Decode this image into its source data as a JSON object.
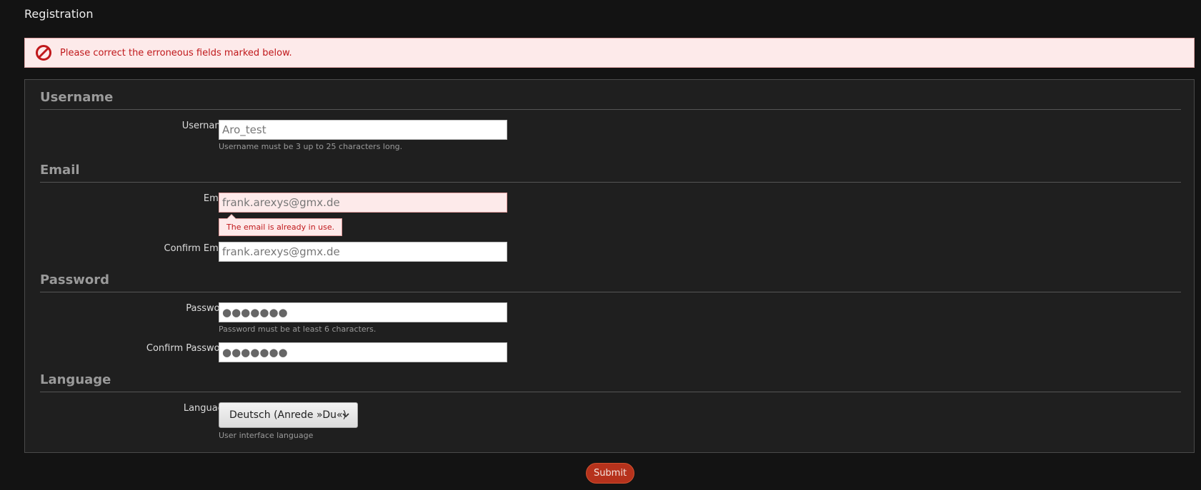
{
  "page": {
    "title": "Registration"
  },
  "alert": {
    "message": "Please correct the erroneous fields marked below.",
    "icon": "no-entry-icon",
    "color": "#c0181b"
  },
  "sections": {
    "username": {
      "title": "Username",
      "label": "Username",
      "value": "Aro_test",
      "help": "Username must be 3 up to 25 characters long."
    },
    "email": {
      "title": "Email",
      "label": "Email",
      "value": "frank.arexys@gmx.de",
      "error": "The email is already in use.",
      "confirm_label": "Confirm Email",
      "confirm_value": "frank.arexys@gmx.de"
    },
    "password": {
      "title": "Password",
      "label": "Password",
      "value": "●●●●●●●",
      "help": "Password must be at least 6 characters.",
      "confirm_label": "Confirm Password",
      "confirm_value": "●●●●●●●"
    },
    "language": {
      "title": "Language",
      "label": "Language",
      "selected": "Deutsch (Anrede »Du«)",
      "help": "User interface language"
    }
  },
  "submit": {
    "label": "Submit",
    "color": "#b6321c"
  }
}
